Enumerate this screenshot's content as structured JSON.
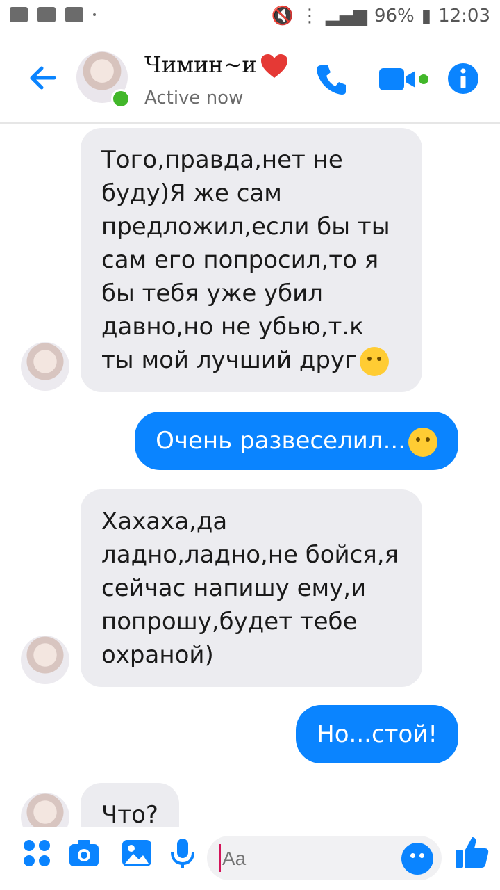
{
  "status_bar": {
    "battery": "96%",
    "time": "12:03"
  },
  "header": {
    "name": "Чимин~и",
    "status": "Active now"
  },
  "messages": [
    {
      "text": "Того,правда,нет не буду)Я же сам предложил,если бы ты сам его попросил,то я бы тебя уже убил давно,но не убью,т.к ты мой лучший друг"
    },
    {
      "text": "Очень развеселил..."
    },
    {
      "text": "Хахаха,да ладно,ладно,не бойся,я сейчас напишу ему,и попрошу,будет тебе охраной)"
    },
    {
      "text": "Но...стой!"
    },
    {
      "text": "Что?"
    }
  ],
  "composer": {
    "placeholder": "Aa"
  },
  "colors": {
    "accent": "#0a84ff",
    "incoming_bubble": "#ececf0",
    "online": "#42b72a"
  }
}
